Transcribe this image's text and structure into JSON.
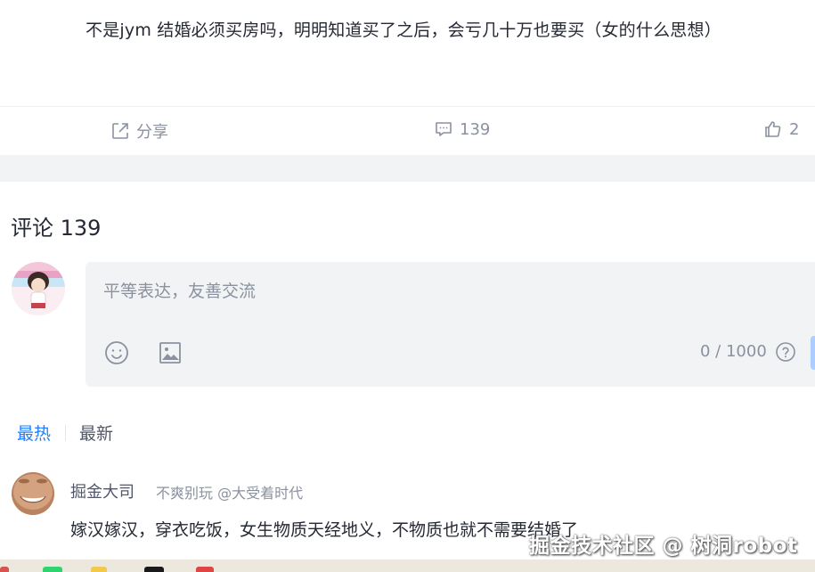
{
  "post": {
    "text": "不是jym 结婚必须买房吗，明明知道买了之后，会亏几十万也要买（女的什么思想）"
  },
  "actions": {
    "share_label": "分享",
    "comment_count": "139",
    "like_count": "2"
  },
  "comments": {
    "title": "评论 139",
    "editor": {
      "placeholder": "平等表达，友善交流",
      "counter": "0 / 1000"
    },
    "tabs": {
      "hot": "最热",
      "new": "最新"
    },
    "items": [
      {
        "author": "掘金大司",
        "meta": "不爽别玩 @大受着时代",
        "content": "嫁汉嫁汉，穿衣吃饭，女生物质天经地义，不物质也就不需要结婚了"
      }
    ]
  },
  "watermark": "掘金技术社区 @ 树洞robot",
  "colors": {
    "accent": "#1e80ff",
    "muted": "#8a919f",
    "band": "#f2f3f5"
  },
  "icons": [
    "share-icon",
    "comment-icon",
    "thumbs-up-icon",
    "emoji-icon",
    "image-icon",
    "help-icon"
  ]
}
